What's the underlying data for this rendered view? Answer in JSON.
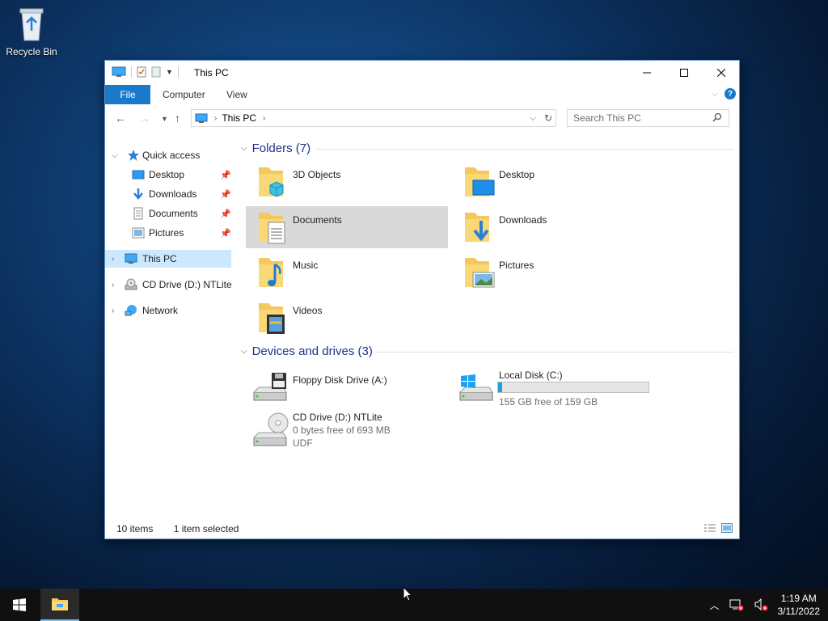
{
  "desktop": {
    "recycle_bin_label": "Recycle Bin"
  },
  "window": {
    "title": "This PC",
    "ribbon_tabs": [
      "File",
      "Computer",
      "View"
    ],
    "address": {
      "crumb": "This PC"
    },
    "search": {
      "placeholder": "Search This PC"
    }
  },
  "navpane": {
    "quick_access": "Quick access",
    "pinned": [
      "Desktop",
      "Downloads",
      "Documents",
      "Pictures"
    ],
    "this_pc": "This PC",
    "cd_drive": "CD Drive (D:) NTLite",
    "network": "Network"
  },
  "content": {
    "folders_header": "Folders (7)",
    "folders": [
      "3D Objects",
      "Desktop",
      "Documents",
      "Downloads",
      "Music",
      "Pictures",
      "Videos"
    ],
    "devices_header": "Devices and drives (3)",
    "drives": {
      "floppy": {
        "name": "Floppy Disk Drive (A:)"
      },
      "local": {
        "name": "Local Disk (C:)",
        "free": "155 GB free of 159 GB",
        "used_fraction": 0.025
      },
      "cd": {
        "name": "CD Drive (D:) NTLite",
        "free": "0 bytes free of 693 MB",
        "fs": "UDF"
      }
    }
  },
  "status": {
    "items": "10 items",
    "selected": "1 item selected"
  },
  "taskbar": {
    "time": "1:19 AM",
    "date": "3/11/2022"
  },
  "colors": {
    "accent": "#1979ca",
    "selection": "#cce8ff",
    "folder": "#f4c85b",
    "header_text": "#1e3287"
  }
}
